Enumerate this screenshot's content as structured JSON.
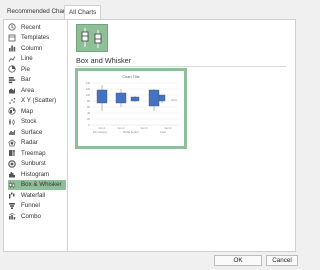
{
  "tabs": [
    "Recommended Charts",
    "All Charts"
  ],
  "sidebar": {
    "items": [
      {
        "label": "Recent",
        "icon": "recent-icon"
      },
      {
        "label": "Templates",
        "icon": "templates-icon"
      },
      {
        "label": "Column",
        "icon": "column-chart-icon"
      },
      {
        "label": "Line",
        "icon": "line-chart-icon"
      },
      {
        "label": "Pie",
        "icon": "pie-chart-icon"
      },
      {
        "label": "Bar",
        "icon": "bar-chart-icon"
      },
      {
        "label": "Area",
        "icon": "area-chart-icon"
      },
      {
        "label": "X Y (Scatter)",
        "icon": "scatter-chart-icon"
      },
      {
        "label": "Map",
        "icon": "map-chart-icon"
      },
      {
        "label": "Stock",
        "icon": "stock-chart-icon"
      },
      {
        "label": "Surface",
        "icon": "surface-chart-icon"
      },
      {
        "label": "Radar",
        "icon": "radar-chart-icon"
      },
      {
        "label": "Treemap",
        "icon": "treemap-chart-icon"
      },
      {
        "label": "Sunburst",
        "icon": "sunburst-chart-icon"
      },
      {
        "label": "Histogram",
        "icon": "histogram-chart-icon"
      },
      {
        "label": "Box & Whisker",
        "icon": "box-whisker-chart-icon",
        "selected": true
      },
      {
        "label": "Waterfall",
        "icon": "waterfall-chart-icon"
      },
      {
        "label": "Funnel",
        "icon": "funnel-chart-icon"
      },
      {
        "label": "Combo",
        "icon": "combo-chart-icon"
      }
    ]
  },
  "main": {
    "subtype_icon": "box-whisker-chart-icon",
    "subtitle": "Box and Whisker",
    "preview": {
      "title": "Chart Title",
      "ytick_labels": [
        "140",
        "120",
        "100",
        "80",
        "60",
        "40",
        "20",
        "0"
      ],
      "xtick_labels": [
        "Item 1",
        "Item 2",
        "Item 3",
        "Item 4"
      ],
      "xlabels_bottom": [
        "Sub Category",
        "Middle Section",
        "Final"
      ]
    }
  },
  "footer": {
    "ok_label": "OK",
    "cancel_label": "Cancel"
  },
  "colors": {
    "accent": "#8fbf97",
    "box": "#4472c4"
  }
}
